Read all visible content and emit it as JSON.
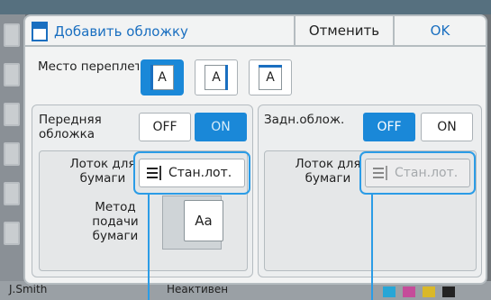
{
  "background": {
    "user": "J.Smith",
    "status": "Неактивен"
  },
  "dialog": {
    "title": "Добавить обложку",
    "cancel_label": "Отменить",
    "ok_label": "OK"
  },
  "binding": {
    "label": "Место переплета",
    "options": [
      "A",
      "A",
      "A"
    ],
    "selected": 0
  },
  "front_cover": {
    "label_line1": "Передняя",
    "label_line2": "обложка",
    "off_label": "OFF",
    "on_label": "ON",
    "selected": "ON",
    "tray_label_line1": "Лоток для",
    "tray_label_line2": "бумаги",
    "tray_value": "Стан.лот.",
    "feed_label_line1": "Метод",
    "feed_label_line2": "подачи",
    "feed_label_line3": "бумаги",
    "feed_value": "Aa"
  },
  "back_cover": {
    "label": "Задн.облож.",
    "off_label": "OFF",
    "on_label": "ON",
    "selected": "OFF",
    "tray_label_line1": "Лоток для",
    "tray_label_line2": "бумаги",
    "tray_value": "Стан.лот."
  },
  "colors": {
    "accent": "#1a88d8",
    "callout": "#2b9ce6",
    "title_blue": "#1a6fc0"
  }
}
